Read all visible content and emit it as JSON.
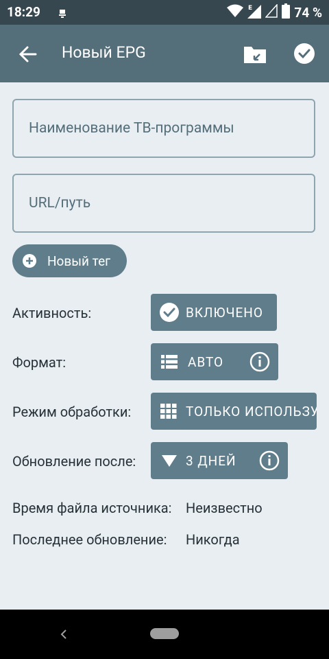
{
  "status_bar": {
    "time": "18:29",
    "battery": "74 %",
    "icons": [
      "notification-icon",
      "wifi-icon",
      "signal-e-icon",
      "signal-empty-icon",
      "battery-icon"
    ]
  },
  "toolbar": {
    "title": "Новый EPG",
    "icons": [
      "back-arrow-icon",
      "folder-import-icon",
      "check-circle-icon"
    ]
  },
  "form": {
    "name_placeholder": "Наименование ТВ-программы",
    "url_placeholder": "URL/путь",
    "name_value": "",
    "url_value": ""
  },
  "tag_chip": {
    "label": "Новый тег",
    "icon": "plus-circle-icon"
  },
  "settings": {
    "activity": {
      "label": "Активность:",
      "value": "ВКЛЮЧЕНО",
      "icon": "check-circle-icon"
    },
    "format": {
      "label": "Формат:",
      "value": "АВТО",
      "icon": "list-icon",
      "info_icon": "info-icon"
    },
    "mode": {
      "label": "Режим обработки:",
      "value": "ТОЛЬКО ИСПОЛЬЗУ",
      "icon": "grid-icon"
    },
    "update": {
      "label": "Обновление после:",
      "value": "3 ДНЕЙ",
      "icon": "triangle-down-icon",
      "info_icon": "info-icon"
    }
  },
  "info": {
    "file_time": {
      "label": "Время файла источника:",
      "value": "Неизвестно"
    },
    "last_update": {
      "label": "Последнее обновление:",
      "value": "Никогда"
    }
  },
  "colors": {
    "status_bar": "#37474f",
    "toolbar": "#546e7a",
    "button": "#607d8b",
    "background": "#e9eef2",
    "text": "#263238"
  }
}
